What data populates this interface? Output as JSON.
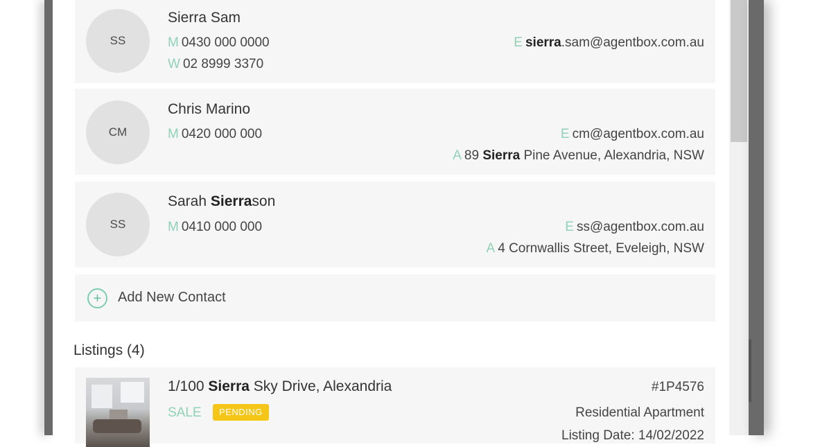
{
  "contacts": [
    {
      "initials": "SS",
      "name_pre": "",
      "name_bold": "",
      "name_post": "Sierra Sam",
      "mobile_label": "M",
      "mobile": "0430 000 0000",
      "work_label": "W",
      "work": "02 8999 3370",
      "email_label": "E",
      "email_bold": "sierra",
      "email_rest": ".sam@agentbox.com.au"
    },
    {
      "initials": "CM",
      "name": "Chris Marino",
      "mobile_label": "M",
      "mobile": "0420 000 000",
      "email_label": "E",
      "email": "cm@agentbox.com.au",
      "address_label": "A",
      "address_pre": "89 ",
      "address_bold": "Sierra",
      "address_post": " Pine Avenue, Alexandria, NSW"
    },
    {
      "initials": "SS",
      "name_pre": "Sarah ",
      "name_bold": "Sierra",
      "name_post": "son",
      "mobile_label": "M",
      "mobile": "0410 000 000",
      "email_label": "E",
      "email": "ss@agentbox.com.au",
      "address_label": "A",
      "address": "4 Cornwallis Street, Eveleigh, NSW"
    }
  ],
  "add_contact_label": "Add New Contact",
  "add_contact_icon": "plus-circle-icon",
  "listings_title": "Listings (4)",
  "listing": {
    "title_pre": "1/100 ",
    "title_bold": "Sierra",
    "title_post": " Sky Drive, Alexandria",
    "sale_type": "SALE",
    "status": "PENDING",
    "reference": "#1P4576",
    "property_type": "Residential Apartment",
    "listing_date": "Listing Date: 14/02/2022"
  },
  "colors": {
    "label_accent": "#8fd2b8",
    "badge": "#f5c518",
    "card_bg": "#f6f6f6",
    "bezel": "#6a6a6a"
  }
}
